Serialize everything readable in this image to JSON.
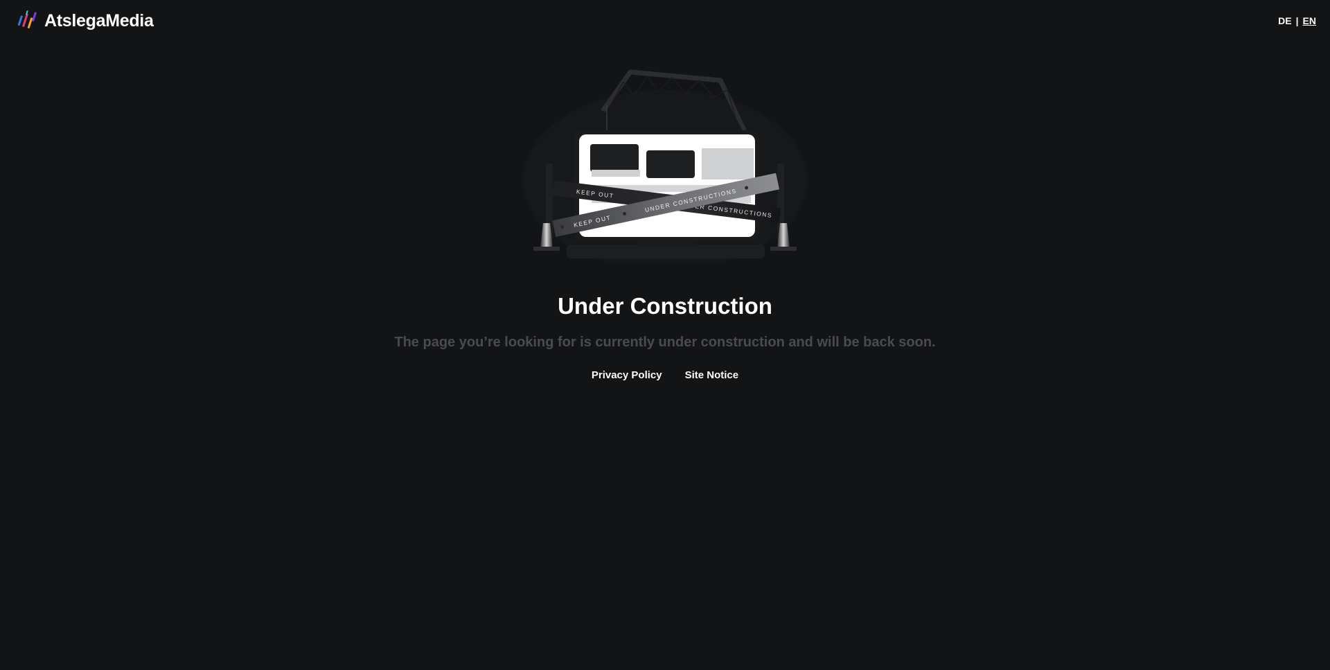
{
  "header": {
    "brand_name": "AtslegaMedia",
    "brand_logo_icon": "color-slashes-logo-icon",
    "languages": [
      {
        "label": "DE",
        "active": false
      },
      {
        "label": "EN",
        "active": true
      }
    ],
    "language_separator": "|"
  },
  "illustration": {
    "icon": "under-construction-illustration",
    "tape_text_1": "KEEP OUT",
    "tape_text_2": "UNDER CONSTRUCTIONS"
  },
  "main": {
    "title": "Under Construction",
    "subtitle": "The page you’re looking for is currently under construction and will be back soon."
  },
  "footer": {
    "links": [
      {
        "label": "Privacy Policy"
      },
      {
        "label": "Site Notice"
      }
    ]
  },
  "colors": {
    "background": "#131416",
    "text_primary": "#ffffff",
    "text_muted": "#4a4b4e",
    "logo_stripes": [
      "#2f7de1",
      "#e63b6f",
      "#f5a623",
      "#7a3fe4"
    ]
  }
}
